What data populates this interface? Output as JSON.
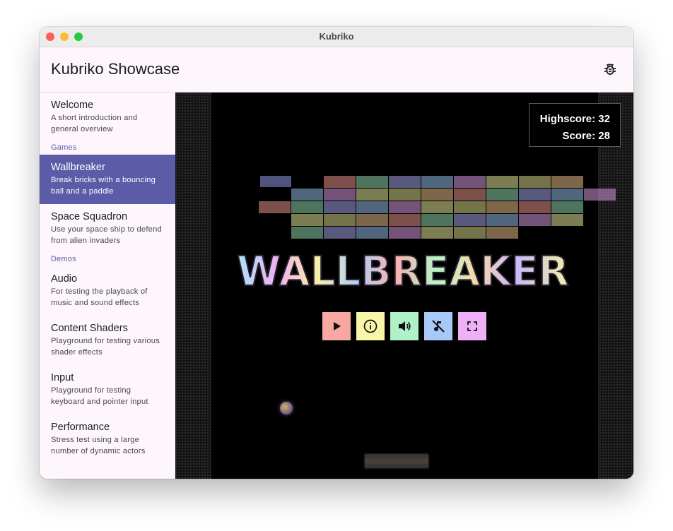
{
  "window": {
    "title": "Kubriko"
  },
  "app": {
    "title": "Kubriko Showcase"
  },
  "sidebar": {
    "welcome": {
      "title": "Welcome",
      "desc": "A short introduction and general overview"
    },
    "games_section": "Games",
    "wallbreaker": {
      "title": "Wallbreaker",
      "desc": "Break bricks with a bouncing ball and a paddle"
    },
    "space_squadron": {
      "title": "Space Squadron",
      "desc": "Use your space ship to defend from alien invaders"
    },
    "demos_section": "Demos",
    "audio": {
      "title": "Audio",
      "desc": "For testing the playback of music and sound effects"
    },
    "content_shaders": {
      "title": "Content Shaders",
      "desc": "Playground for testing various shader effects"
    },
    "input": {
      "title": "Input",
      "desc": "Playground for testing keyboard and pointer input"
    },
    "performance": {
      "title": "Performance",
      "desc": "Stress test using a large number of dynamic actors"
    }
  },
  "game": {
    "logo_text": "WALLBREAKER",
    "highscore_label": "Highscore: 32",
    "score_label": "Score: 28",
    "highscore": 32,
    "score": 28
  },
  "icons": {
    "bug": "bug-icon",
    "play": "play-icon",
    "info": "info-icon",
    "sound": "volume-icon",
    "music_off": "music-off-icon",
    "fullscreen": "fullscreen-icon"
  },
  "colors": {
    "accent": "#5c5ba8",
    "sidebar_bg": "#fdf6fd",
    "play_button": "#f8a8a0",
    "info_button": "#f8f6a8",
    "sound_button": "#b0f2c8",
    "music_button": "#a8c8f8",
    "fullscreen_button": "#f0b0f8"
  }
}
